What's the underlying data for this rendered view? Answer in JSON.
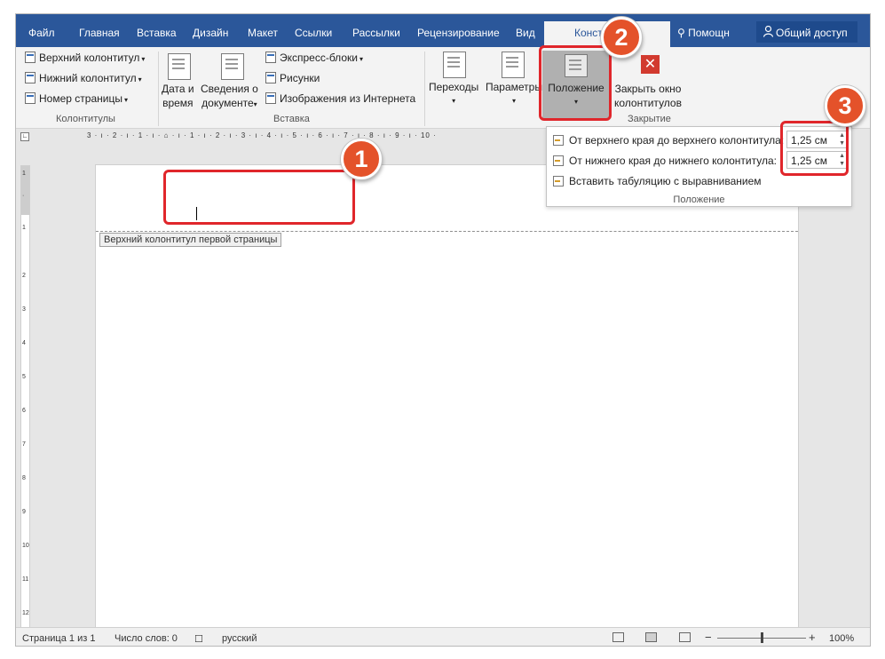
{
  "tabs": [
    "Файл",
    "Главная",
    "Вставка",
    "Дизайн",
    "Макет",
    "Ссылки",
    "Рассылки",
    "Рецензирование",
    "Вид"
  ],
  "active_tab": "Конст",
  "help": "Помощн",
  "share": "Общий доступ",
  "ribbon": {
    "header_label": "Верхний колонтитул",
    "footer_label": "Нижний колонтитул",
    "page_number_label": "Номер страницы",
    "group_headers": "Колонтитулы",
    "date_line1": "Дата и",
    "date_line2": "время",
    "docinfo_line1": "Сведения о",
    "docinfo_line2": "документе",
    "quickparts": "Экспресс-блоки",
    "pictures": "Рисунки",
    "online_pictures": "Изображения из Интернета",
    "group_insert": "Вставка",
    "navigation": "Переходы",
    "options": "Параметры",
    "position": "Положение",
    "close_line1": "Закрыть окно",
    "close_line2": "колонтитулов",
    "group_close": "Закрытие"
  },
  "dropdown": {
    "top_label": "От верхнего края до верхнего колонтитула:",
    "top_value": "1,25 см",
    "bottom_label": "От нижнего края до нижнего колонтитула:",
    "bottom_value": "1,25 см",
    "tab_align": "Вставить табуляцию с выравниванием",
    "group_label": "Положение"
  },
  "ruler_h": "3 · ı · 2 · ı · 1 · ı · ⌂ · ı · 1 · ı · 2 · ı · 3 · ı · 4 · ı · 5 · ı · 6 · ı · 7 · ı · 8 · ı · 9 · ı · 10 ·",
  "ruler_v": [
    "1",
    "·",
    "1",
    "2",
    "3",
    "4",
    "5",
    "6",
    "7",
    "8",
    "9",
    "10",
    "11",
    "12"
  ],
  "page": {
    "header_tag": "Верхний колонтитул первой страницы"
  },
  "status": {
    "page": "Страница 1 из 1",
    "words": "Число слов: 0",
    "lang": "русский",
    "zoom": "100%",
    "zoom_minus": "−",
    "zoom_plus": "+"
  },
  "callouts": [
    "1",
    "2",
    "3"
  ],
  "colors": {
    "ribbon_blue": "#2b579a",
    "callout_red": "#e0262b",
    "badge_orange": "#e4522a"
  }
}
